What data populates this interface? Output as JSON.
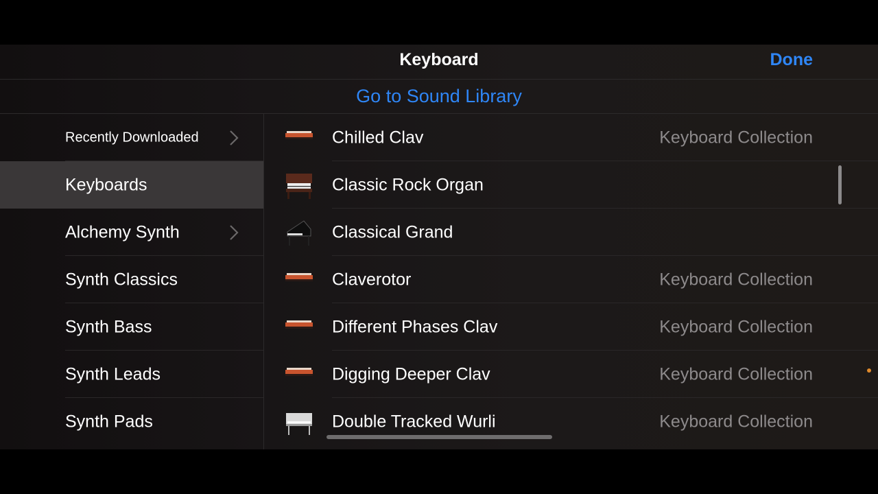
{
  "header": {
    "title": "Keyboard",
    "done_label": "Done"
  },
  "library": {
    "link_label": "Go to Sound Library"
  },
  "sidebar": {
    "items": [
      {
        "label": "Recently Downloaded",
        "chevron": true
      },
      {
        "label": "Keyboards",
        "selected": true
      },
      {
        "label": "Alchemy Synth",
        "chevron": true
      },
      {
        "label": "Synth Classics"
      },
      {
        "label": "Synth Bass"
      },
      {
        "label": "Synth Leads"
      },
      {
        "label": "Synth Pads"
      }
    ]
  },
  "sounds": [
    {
      "name": "Chilled Clav",
      "collection": "Keyboard Collection",
      "icon": "clav-icon"
    },
    {
      "name": "Classic Rock Organ",
      "collection": "",
      "icon": "organ-icon"
    },
    {
      "name": "Classical Grand",
      "collection": "",
      "icon": "grand-piano-icon"
    },
    {
      "name": "Claverotor",
      "collection": "Keyboard Collection",
      "icon": "clav-icon"
    },
    {
      "name": "Different Phases Clav",
      "collection": "Keyboard Collection",
      "icon": "clav-icon"
    },
    {
      "name": "Digging Deeper Clav",
      "collection": "Keyboard Collection",
      "icon": "clav-icon"
    },
    {
      "name": "Double Tracked Wurli",
      "collection": "Keyboard Collection",
      "icon": "electric-piano-icon"
    }
  ],
  "colors": {
    "accent": "#2f86f6",
    "indicator": "#e08a2c"
  }
}
